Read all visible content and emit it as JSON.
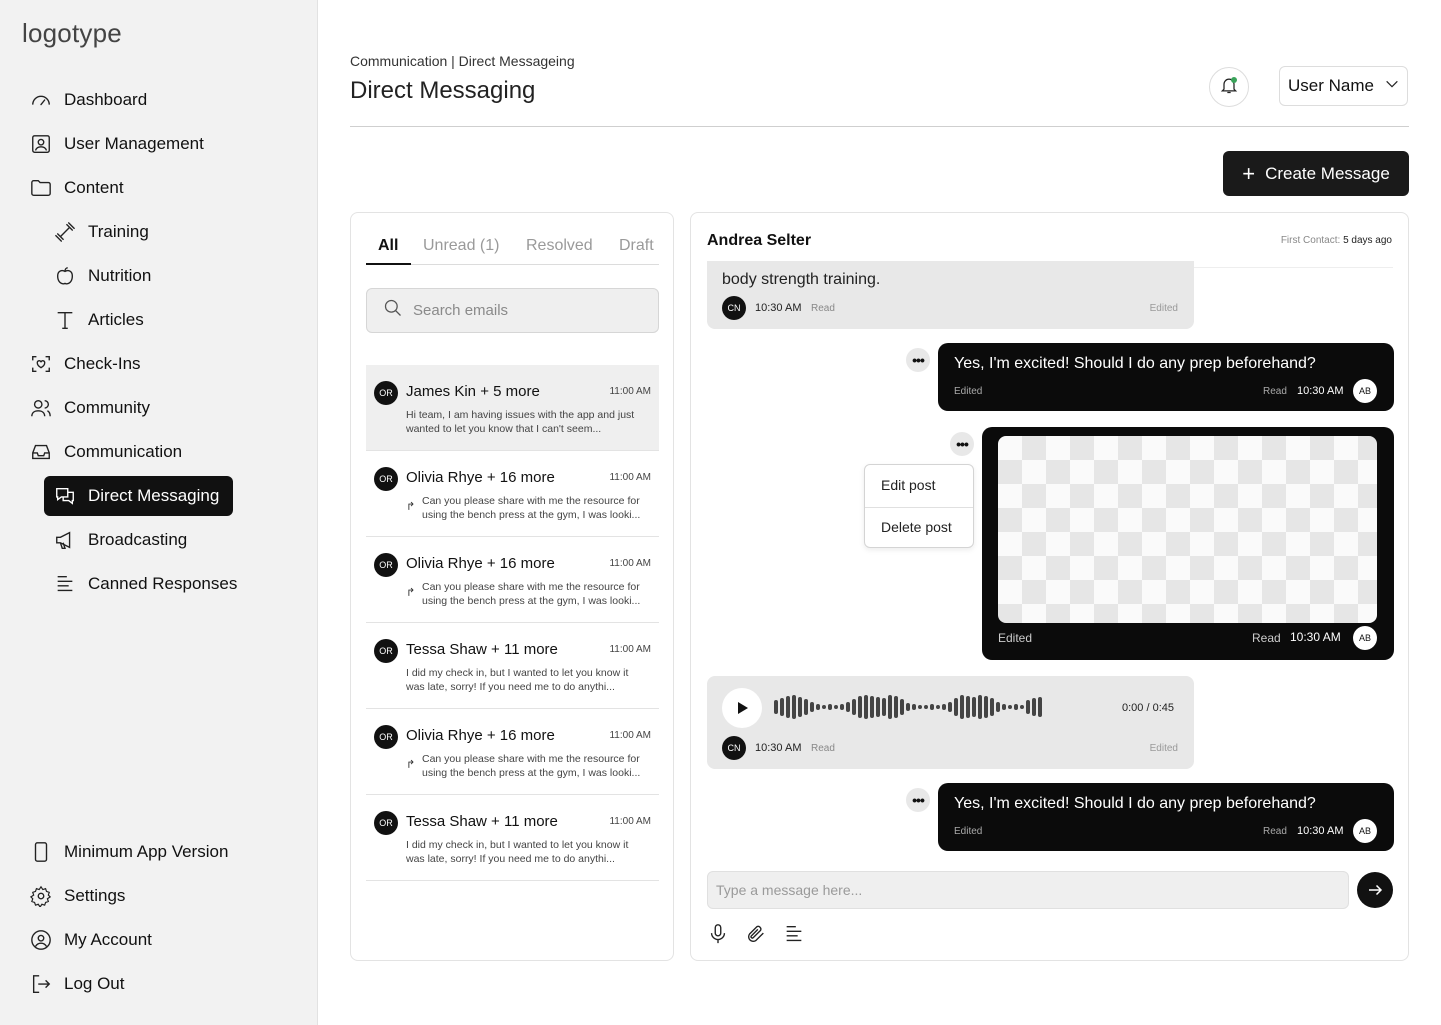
{
  "sidebar": {
    "logo": "logotype",
    "items": [
      {
        "label": "Dashboard"
      },
      {
        "label": "User Management"
      },
      {
        "label": "Content"
      },
      {
        "label": "Training"
      },
      {
        "label": "Nutrition"
      },
      {
        "label": "Articles"
      },
      {
        "label": "Check-Ins"
      },
      {
        "label": "Community"
      },
      {
        "label": "Communication"
      },
      {
        "label": "Direct Messaging"
      },
      {
        "label": "Broadcasting"
      },
      {
        "label": "Canned Responses"
      }
    ],
    "bottom": [
      {
        "label": "Minimum App Version"
      },
      {
        "label": "Settings"
      },
      {
        "label": "My Account"
      },
      {
        "label": "Log Out"
      }
    ]
  },
  "header": {
    "breadcrumb": "Communication | Direct Messageing",
    "title": "Direct Messaging",
    "user_name": "User Name",
    "create_label": "Create Message"
  },
  "inbox": {
    "tabs": [
      {
        "label": "All"
      },
      {
        "label": "Unread (1)"
      },
      {
        "label": "Resolved"
      },
      {
        "label": "Draft"
      }
    ],
    "search_placeholder": "Search emails",
    "threads": [
      {
        "initials": "OR",
        "name": "James Kin + 5 more",
        "time": "11:00 AM",
        "preview": "Hi team, I am having issues with the app and just wanted to let you know that I can't seem..."
      },
      {
        "initials": "OR",
        "name": "Olivia Rhye + 16 more",
        "time": "11:00 AM",
        "preview": "Can you please share with me the resource for using the bench press at the gym, I was looki..."
      },
      {
        "initials": "OR",
        "name": "Olivia Rhye + 16 more",
        "time": "11:00 AM",
        "preview": "Can you please share with me the resource for using the bench press at the gym, I was looki..."
      },
      {
        "initials": "OR",
        "name": "Tessa Shaw + 11 more",
        "time": "11:00 AM",
        "preview": "I did my check in, but I wanted to let you know it was late, sorry! If you need me to do anythi..."
      },
      {
        "initials": "OR",
        "name": "Olivia Rhye + 16 more",
        "time": "11:00 AM",
        "preview": "Can you please share with me the resource for using the bench press at the gym, I was looki..."
      },
      {
        "initials": "OR",
        "name": "Tessa Shaw + 11 more",
        "time": "11:00 AM",
        "preview": "I did my check in, but I wanted to let you know it was late, sorry! If you need me to do anythi..."
      }
    ]
  },
  "chat": {
    "contact": "Andrea Selter",
    "first_contact_label": "First Contact:",
    "first_contact_value": "5 days ago",
    "msg1": {
      "text": "body strength training.",
      "initials": "CN",
      "time": "10:30 AM",
      "read": "Read",
      "edited": "Edited"
    },
    "msg2": {
      "text": "Yes, I'm excited! Should I do any prep beforehand?",
      "initials": "AB",
      "time": "10:30 AM",
      "read": "Read",
      "edited": "Edited"
    },
    "msg3": {
      "initials": "AB",
      "time": "10:30 AM",
      "read": "Read",
      "edited": "Edited"
    },
    "menu": {
      "edit": "Edit post",
      "delete": "Delete post"
    },
    "audio": {
      "duration": "0:00 / 0:45",
      "initials": "CN",
      "time": "10:30 AM",
      "read": "Read",
      "edited": "Edited"
    },
    "msg4": {
      "text": "Yes, I'm excited! Should I do any prep beforehand?",
      "initials": "AB",
      "time": "10:30 AM",
      "read": "Read",
      "edited": "Edited"
    },
    "composer_placeholder": "Type a message here..."
  }
}
